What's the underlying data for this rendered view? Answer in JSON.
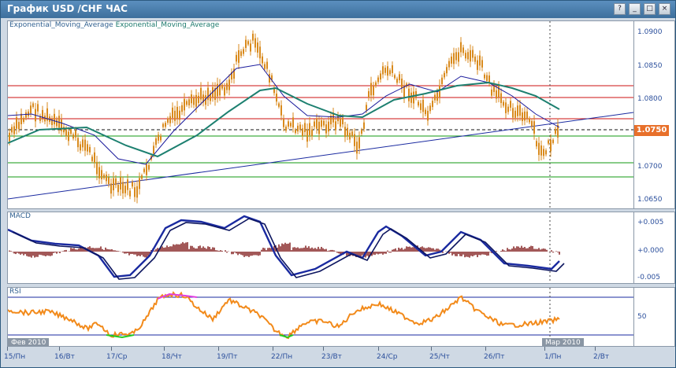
{
  "window": {
    "title": "График USD /CHF  ЧАС",
    "buttons": [
      "?",
      "_",
      "□",
      "×"
    ]
  },
  "main_chart": {
    "indicator_label_1": "Exponential_Moving_Average",
    "indicator_label_2": "Exponential_Moving_Average",
    "price_ticks": [
      "1.0900",
      "1.0850",
      "1.0800",
      "1.0750",
      "1.0700",
      "1.0650"
    ],
    "current_price": "1.0750",
    "colors": {
      "candles": "#d98a1c",
      "ema_fast": "#1a1a9c",
      "ema_slow": "#1d8070",
      "resistance": "#cc1111",
      "support": "#119911",
      "trendline": "#1a2aa0"
    }
  },
  "macd": {
    "label": "MACD",
    "ticks": [
      "+0.005",
      "+0.000",
      "-0.005"
    ],
    "colors": {
      "line": "#1a2aa0",
      "histogram": "#7a1010"
    }
  },
  "rsi": {
    "label": "RSI",
    "ticks": [
      "50"
    ],
    "colors": {
      "line": "#f28a1a",
      "overbought": "#e040e0",
      "oversold": "#22cc22",
      "levels": "#1a2aa0"
    }
  },
  "month_tags": {
    "left": "Фев 2010",
    "right": "Мар 2010"
  },
  "x_axis": [
    "15/Пн",
    "16/Вт",
    "17/Ср",
    "18/Чт",
    "19/Пт",
    "22/Пн",
    "23/Вт",
    "24/Ср",
    "25/Чт",
    "26/Пт",
    "1/Пн",
    "2/Вт"
  ]
}
